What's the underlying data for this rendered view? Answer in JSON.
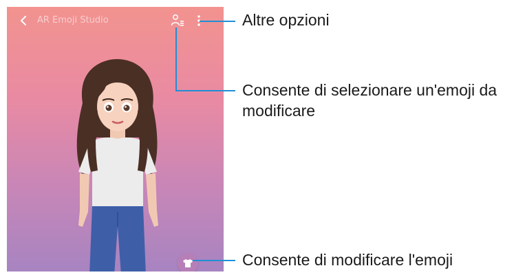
{
  "screen": {
    "title": "AR Emoji Studio",
    "back_icon": "chevron-left-icon",
    "select_emoji_icon": "person-list-icon",
    "more_options_icon": "more-vertical-icon",
    "edit_emoji_icon": "shirt-icon"
  },
  "callouts": {
    "more_options": "Altre opzioni",
    "select_emoji_line1": "Consente di selezionare un'emoji da",
    "select_emoji_line2": "modificare",
    "edit_emoji": "Consente di modificare l'emoji"
  },
  "colors": {
    "callout_line": "#1e8fd6",
    "gradient_top": "#f2938f",
    "gradient_bottom": "#a784c1",
    "edit_button": "#b77fb8"
  }
}
